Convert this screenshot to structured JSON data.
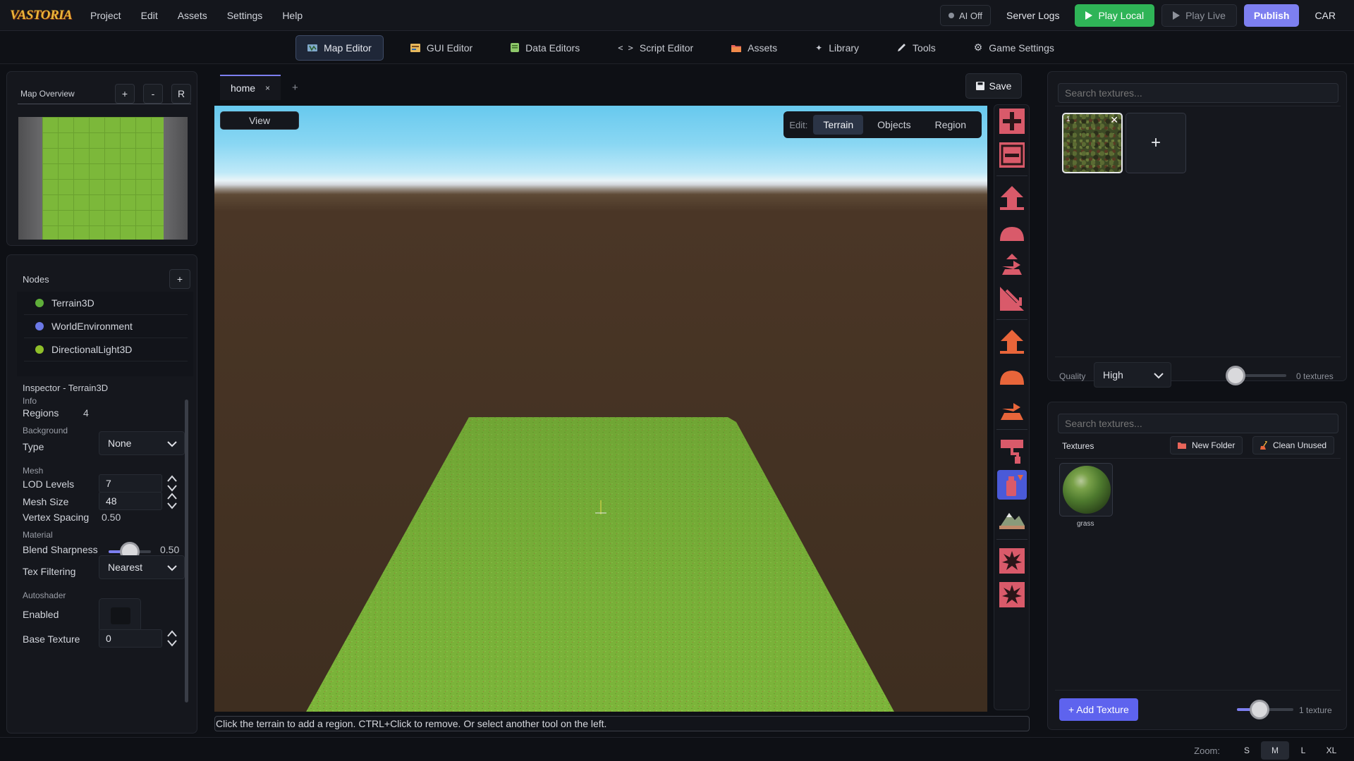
{
  "app": {
    "logo_text": "VASTORIA"
  },
  "menu": [
    "Project",
    "Edit",
    "Assets",
    "Settings",
    "Help"
  ],
  "top_right": {
    "ai_label": "AI Off",
    "server_logs": "Server Logs",
    "play_local": "Play Local",
    "play_live": "Play Live",
    "publish": "Publish",
    "user": "CAR"
  },
  "tool_tabs": [
    {
      "label": "Map Editor",
      "icon": "map-icon",
      "active": true
    },
    {
      "label": "GUI Editor",
      "icon": "gui-icon"
    },
    {
      "label": "Data Editors",
      "icon": "data-icon"
    },
    {
      "label": "Script Editor",
      "icon": "code-icon"
    },
    {
      "label": "Assets",
      "icon": "folder-icon"
    },
    {
      "label": "Library",
      "icon": "sparkle-icon"
    },
    {
      "label": "Tools",
      "icon": "pencil-icon"
    },
    {
      "label": "Game Settings",
      "icon": "gear-icon"
    }
  ],
  "map_overview": {
    "title": "Map Overview",
    "zoom_in": "+",
    "zoom_out": "-",
    "reset": "R"
  },
  "nodes": {
    "title": "Nodes",
    "add": "+",
    "items": [
      {
        "label": "Terrain3D",
        "color": "#5fae3a"
      },
      {
        "label": "WorldEnvironment",
        "color": "#6b78e6"
      },
      {
        "label": "DirectionalLight3D",
        "color": "#8fbf2a"
      }
    ]
  },
  "inspector": {
    "title": "Inspector - Terrain3D",
    "info_section": "Info",
    "regions_label": "Regions",
    "regions_value": "4",
    "background_section": "Background",
    "type_label": "Type",
    "type_value": "None",
    "mesh_section": "Mesh",
    "lod_label": "LOD Levels",
    "lod_value": "7",
    "mesh_size_label": "Mesh Size",
    "mesh_size_value": "48",
    "vertex_spacing_label": "Vertex Spacing",
    "vertex_spacing_value": "0.50",
    "material_section": "Material",
    "blend_label": "Blend Sharpness",
    "blend_value": "0.50",
    "blend_fraction": 0.5,
    "tex_filter_label": "Tex Filtering",
    "tex_filter_value": "Nearest",
    "autoshader_section": "Autoshader",
    "enabled_label": "Enabled",
    "enabled": false,
    "base_texture_label": "Base Texture",
    "base_texture_value": "0"
  },
  "editor": {
    "tab_label": "home",
    "tab_close": "×",
    "add_tab": "+",
    "save_label": "Save",
    "view_label": "View",
    "edit_label": "Edit:",
    "edit_modes": [
      "Terrain",
      "Objects",
      "Region"
    ],
    "active_mode": "Terrain",
    "status": "Click the terrain to add a region. CTRL+Click to remove. Or select another tool on the left."
  },
  "tools": [
    "add-region-icon",
    "remove-region-icon",
    "raise-icon",
    "smooth-mound-icon",
    "height-arrow-icon",
    "slope-icon",
    "raise-orange-icon",
    "mound-orange-icon",
    "flatten-orange-icon",
    "paint-roller-icon",
    "spray-paint-icon",
    "mountain-icon",
    "autoshader-icon",
    "holes-icon"
  ],
  "texture_panel": {
    "search_placeholder": "Search textures...",
    "slot_index": "1",
    "remove": "✕",
    "add": "+",
    "quality_label": "Quality",
    "quality_value": "High",
    "quality_count": "0 textures",
    "quality_fraction": 0.1
  },
  "library_panel": {
    "search_placeholder": "Search textures...",
    "title": "Textures",
    "new_folder": "New Folder",
    "clean_unused": "Clean Unused",
    "items": [
      {
        "label": "grass"
      }
    ],
    "add_texture": "+ Add Texture",
    "count": "1 texture",
    "size_fraction": 0.4
  },
  "zoom": {
    "label": "Zoom:",
    "options": [
      "S",
      "M",
      "L",
      "XL"
    ],
    "active": "M"
  },
  "colors": {
    "accent": "#7d7ff0",
    "play": "#2fb457",
    "tool": "#d95a6a",
    "tool_alt": "#e8653a"
  }
}
